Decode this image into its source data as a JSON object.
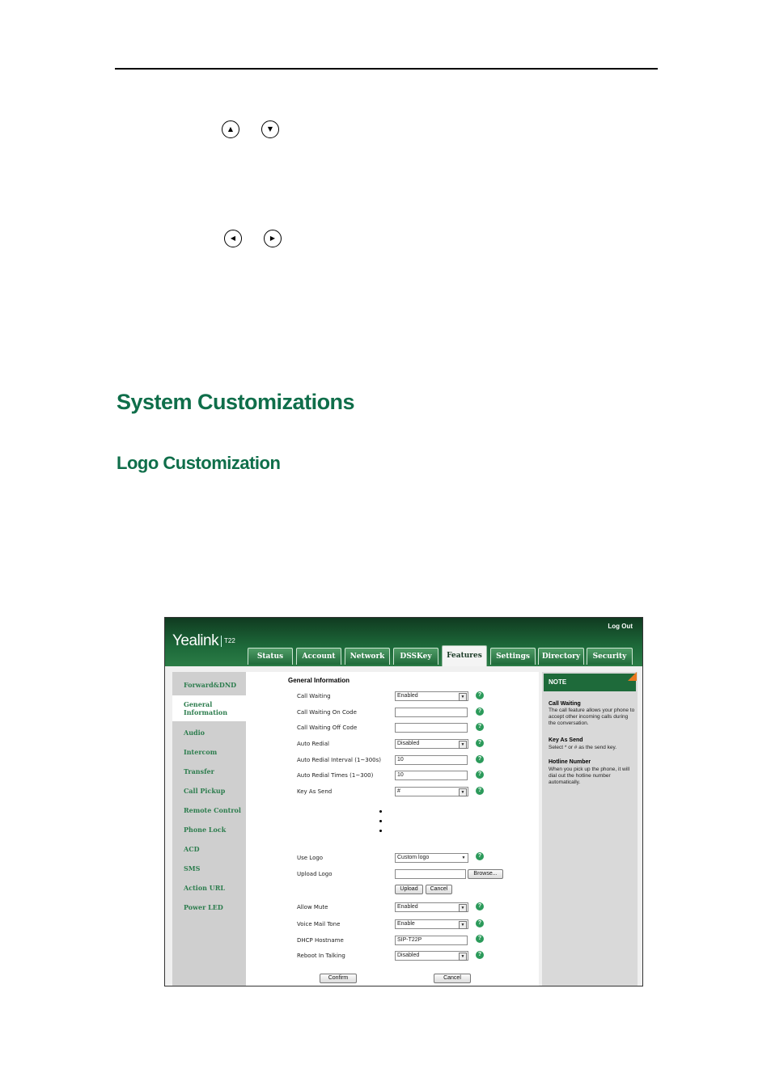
{
  "page": {
    "nav_up_glyph": "▲",
    "nav_down_glyph": "▼",
    "nav_left_glyph": "◀",
    "nav_right_glyph": "▶",
    "heading1": "System Customizations",
    "heading2": "Logo Customization"
  },
  "screenshot": {
    "brand": "Yealink",
    "model": "T22",
    "logout": "Log Out",
    "tabs": [
      {
        "label": "Status",
        "active": false
      },
      {
        "label": "Account",
        "active": false
      },
      {
        "label": "Network",
        "active": false
      },
      {
        "label": "DSSKey",
        "active": false
      },
      {
        "label": "Features",
        "active": true
      },
      {
        "label": "Settings",
        "active": false
      },
      {
        "label": "Directory",
        "active": false
      },
      {
        "label": "Security",
        "active": false
      }
    ],
    "sidebar": [
      "Forward&DND",
      "General Information",
      "Audio",
      "Intercom",
      "Transfer",
      "Call Pickup",
      "Remote Control",
      "Phone Lock",
      "ACD",
      "SMS",
      "Action URL",
      "Power LED"
    ],
    "section_title": "General Information",
    "fields": {
      "call_waiting": {
        "label": "Call Waiting",
        "value": "Enabled"
      },
      "cw_on_code": {
        "label": "Call Waiting On Code",
        "value": ""
      },
      "cw_off_code": {
        "label": "Call Waiting Off Code",
        "value": ""
      },
      "auto_redial": {
        "label": "Auto Redial",
        "value": "Disabled"
      },
      "auto_redial_interval": {
        "label": "Auto Redial Interval (1~300s)",
        "value": "10"
      },
      "auto_redial_times": {
        "label": "Auto Redial Times (1~300)",
        "value": "10"
      },
      "key_as_send": {
        "label": "Key As Send",
        "value": "#"
      },
      "use_logo": {
        "label": "Use Logo",
        "value": "Custom logo"
      },
      "upload_logo": {
        "label": "Upload Logo",
        "value": ""
      },
      "allow_mute": {
        "label": "Allow Mute",
        "value": "Enabled"
      },
      "voice_mail_tone": {
        "label": "Voice Mail Tone",
        "value": "Enable"
      },
      "dhcp_hostname": {
        "label": "DHCP Hostname",
        "value": "SIP-T22P"
      },
      "reboot_in_talking": {
        "label": "Reboot In Talking",
        "value": "Disabled"
      }
    },
    "buttons": {
      "browse": "Browse...",
      "upload": "Upload",
      "cancel_small": "Cancel",
      "confirm": "Confirm",
      "cancel": "Cancel"
    },
    "help_glyph": "?",
    "note": {
      "heading": "NOTE",
      "items": [
        {
          "title": "Call Waiting",
          "text": "The call feature allows your phone to accept other incoming calls during the conversation."
        },
        {
          "title": "Key As Send",
          "text": "Select * or # as the send key."
        },
        {
          "title": "Hotline Number",
          "text": "When you pick up the phone, it will dial out the hotline number automatically."
        }
      ]
    }
  }
}
